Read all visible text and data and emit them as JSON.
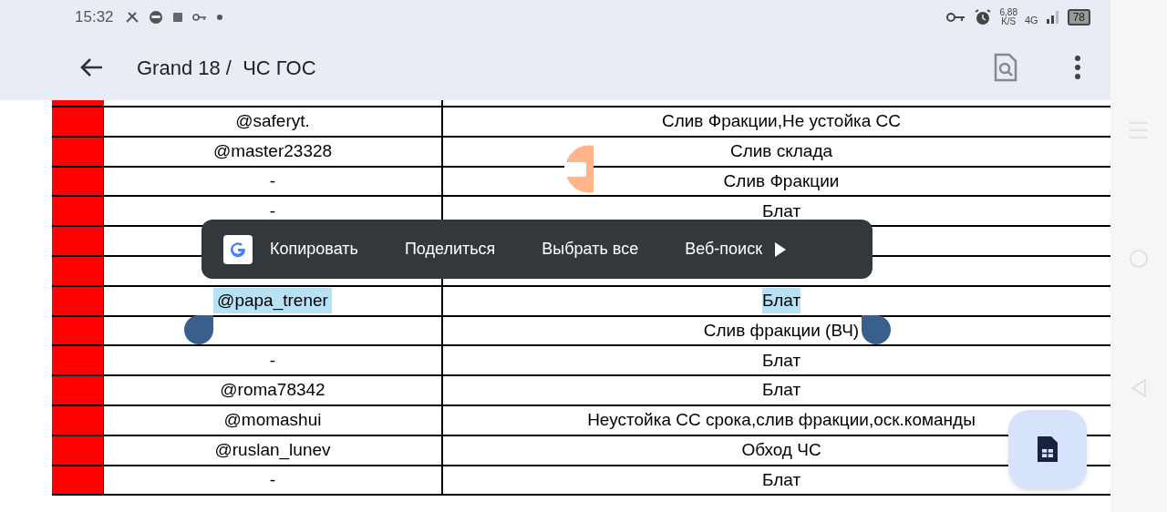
{
  "status_bar": {
    "time": "15:32",
    "speed": "6,88",
    "speed_unit": "K/S",
    "network": "4G",
    "battery": "78"
  },
  "toolbar": {
    "title": "Grand 18 /  ЧС ГОС"
  },
  "table": {
    "rows": [
      {
        "kind": "row",
        "name": "@saferyt.",
        "reason": "Слив Фракции,Не устойка СС",
        "selected": false
      },
      {
        "kind": "row",
        "name": "@master23328",
        "reason": "Слив склада",
        "selected": false
      },
      {
        "kind": "row",
        "name": "-",
        "reason": "Слив Фракции",
        "selected": false
      },
      {
        "kind": "row",
        "name": "-",
        "reason": "Блат",
        "selected": false
      },
      {
        "kind": "selection_menu",
        "items": [
          "Копировать",
          "Поделиться",
          "Выбрать все",
          "Веб-поиск"
        ]
      },
      {
        "kind": "row",
        "name": "@papa_trener",
        "reason": "Блат",
        "selected": true
      },
      {
        "kind": "row",
        "reason": "Слив фракции (ВЧ)",
        "selected": false
      },
      {
        "kind": "row",
        "name": "-",
        "reason": "Блат",
        "selected": false
      },
      {
        "kind": "row",
        "name": "@roma78342",
        "reason": "Блат",
        "selected": false
      },
      {
        "kind": "row",
        "name": "@momashui",
        "reason": "Неустойка СС срока,слив фракции,оск.команды",
        "selected": false
      },
      {
        "kind": "row",
        "name": "@ruslan_lunev",
        "reason": "Обход ЧС",
        "selected": false
      },
      {
        "kind": "row",
        "name": "-",
        "reason": "Блат",
        "selected": false
      }
    ]
  }
}
